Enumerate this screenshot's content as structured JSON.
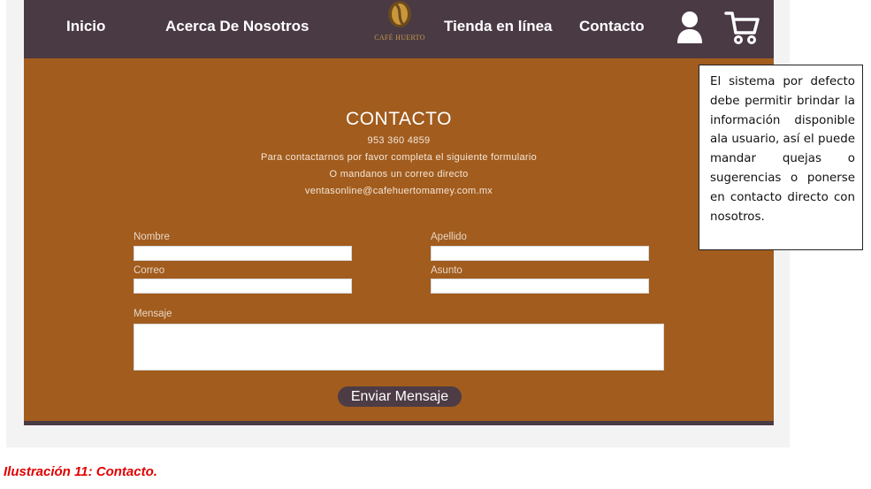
{
  "nav": {
    "home": "Inicio",
    "about": "Acerca De Nosotros",
    "logo_text": "CAFÉ HUERTO",
    "store": "Tienda en línea",
    "contact": "Contacto",
    "icons": [
      "user-icon",
      "cart-icon"
    ]
  },
  "contact": {
    "title": "CONTACTO",
    "phone": "953 360 4859",
    "line1": "Para contactarnos por favor completa el siguiente formulario",
    "line2": "O mandanos un correo directo",
    "email": "ventasonline@cafehuertomamey.com.mx"
  },
  "form": {
    "nombre_label": "Nombre",
    "apellido_label": "Apellido",
    "correo_label": "Correo",
    "asunto_label": "Asunto",
    "mensaje_label": "Mensaje",
    "nombre_value": "",
    "apellido_value": "",
    "correo_value": "",
    "asunto_value": "",
    "mensaje_value": "",
    "submit_label": "Enviar Mensaje"
  },
  "note": {
    "text": "El sistema por defecto debe permitir brindar la información disponible ala usuario, así el puede mandar quejas o sugerencias o ponerse en contacto directo con nosotros."
  },
  "caption": "Ilustración 11: Contacto.",
  "colors": {
    "nav_bg": "#4a3a44",
    "page_bg": "#a15c1e",
    "caption": "#e00000"
  }
}
